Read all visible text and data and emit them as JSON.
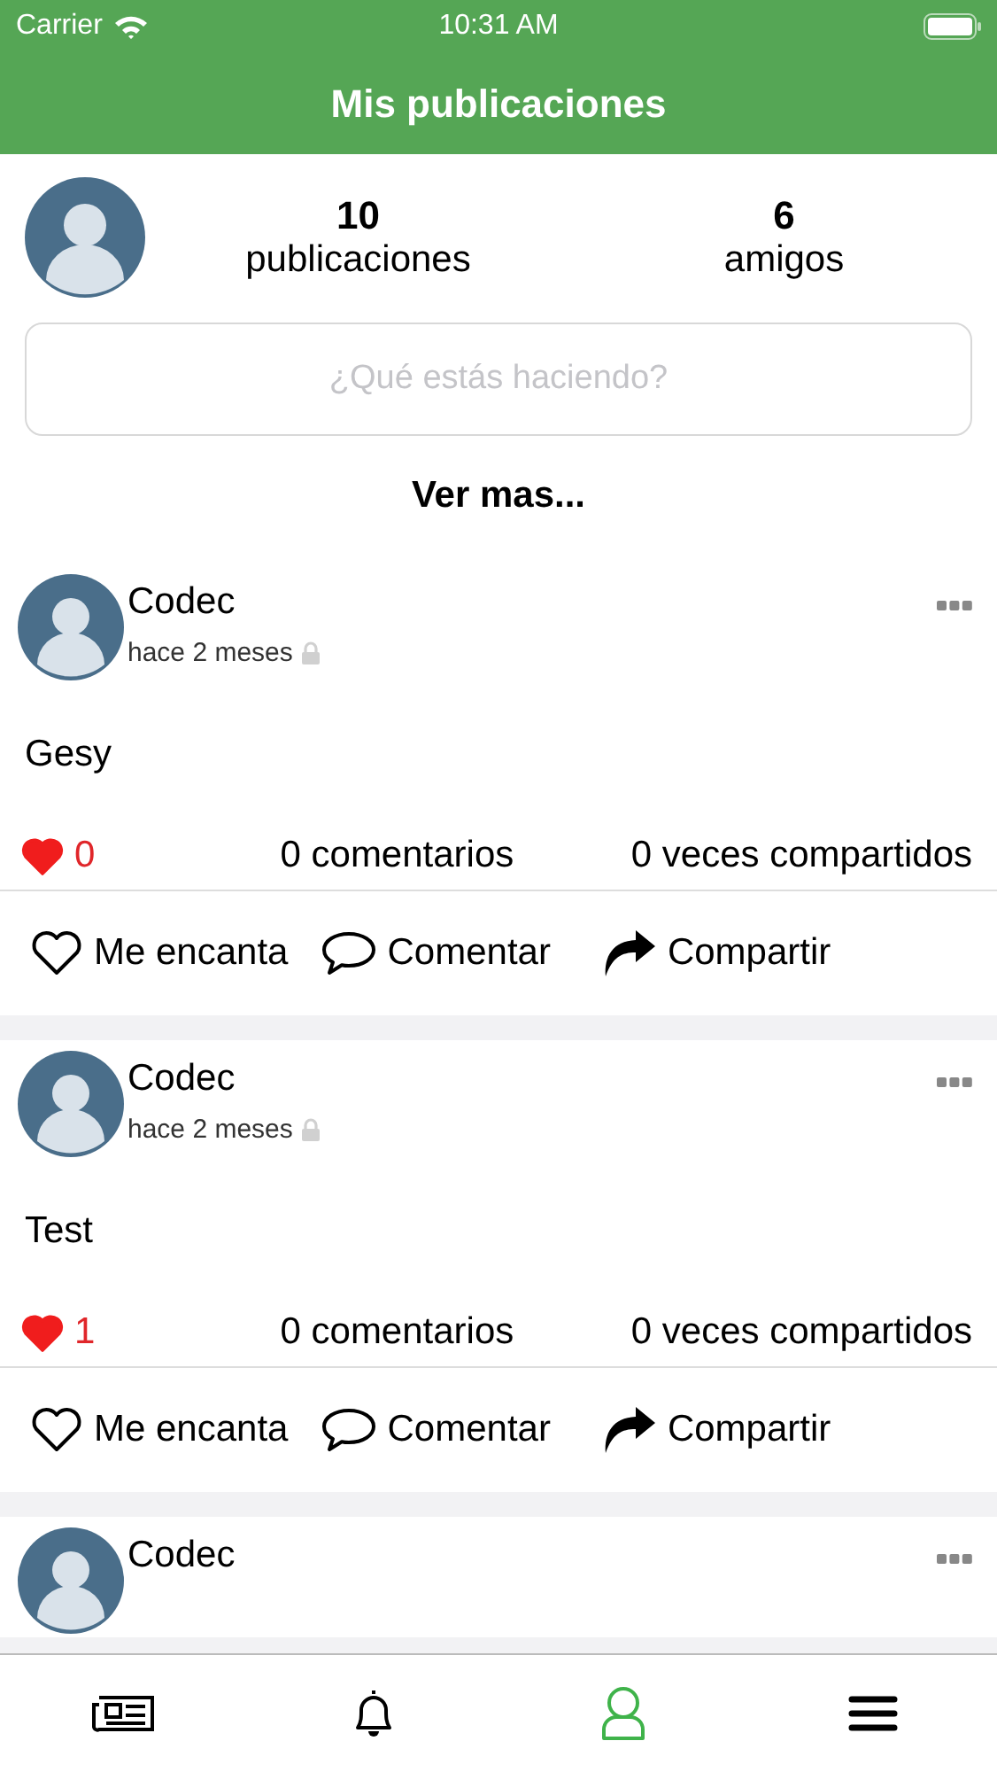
{
  "status_bar": {
    "carrier": "Carrier",
    "time": "10:31 AM"
  },
  "header": {
    "title": "Mis publicaciones"
  },
  "profile": {
    "stats": [
      {
        "value": "10",
        "label": "publicaciones"
      },
      {
        "value": "6",
        "label": "amigos"
      }
    ]
  },
  "composer": {
    "placeholder": "¿Qué estás haciendo?"
  },
  "more_link": "Ver mas...",
  "posts": [
    {
      "author": "Codec",
      "time": "hace 2 meses",
      "private": true,
      "body": "Gesy",
      "liked": true,
      "likes": "0",
      "comments": "0 comentarios",
      "shares": "0 veces compartidos",
      "actions": [
        {
          "kind": "love",
          "label": "Me encanta"
        },
        {
          "kind": "comment",
          "label": "Comentar"
        },
        {
          "kind": "share",
          "label": "Compartir"
        }
      ]
    },
    {
      "author": "Codec",
      "time": "hace 2 meses",
      "private": true,
      "body": "Test",
      "liked": true,
      "likes": "1",
      "comments": "0 comentarios",
      "shares": "0 veces compartidos",
      "actions": [
        {
          "kind": "love",
          "label": "Me encanta"
        },
        {
          "kind": "comment",
          "label": "Comentar"
        },
        {
          "kind": "share",
          "label": "Compartir"
        }
      ]
    },
    {
      "author": "Codec"
    }
  ],
  "tab_bar": [
    {
      "kind": "news",
      "selected": false
    },
    {
      "kind": "bell",
      "selected": false
    },
    {
      "kind": "person",
      "selected": true
    },
    {
      "kind": "menu",
      "selected": false
    }
  ]
}
